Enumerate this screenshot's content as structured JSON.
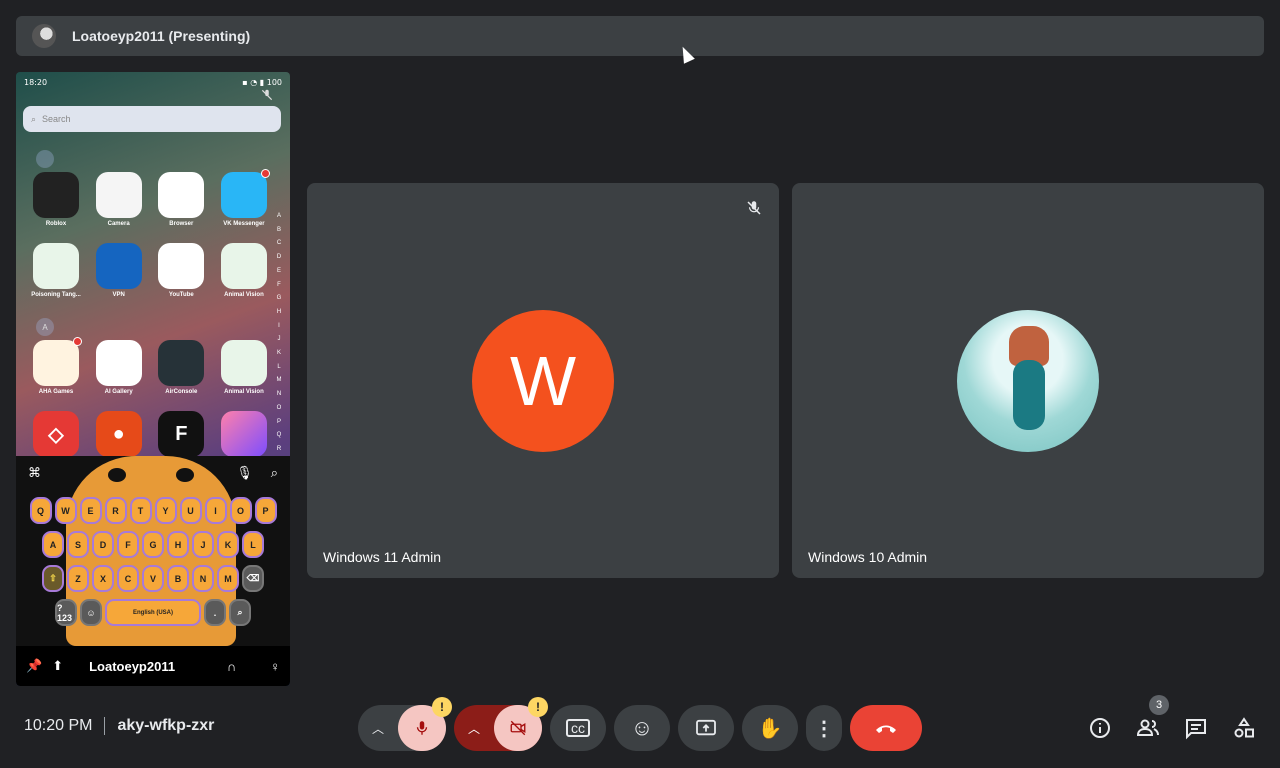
{
  "presenter_bar": {
    "title": "Loatoeyp2011 (Presenting)"
  },
  "phone": {
    "status_time": "18:20",
    "search_placeholder": "Search",
    "apps": [
      [
        {
          "label": "Roblox",
          "icon": "roblox-icon",
          "color": "#222"
        },
        {
          "label": "Camera",
          "icon": "camera-icon",
          "color": "#f5f5f5"
        },
        {
          "label": "Browser",
          "icon": "browser-icon",
          "color": "#ffffff"
        },
        {
          "label": "VK Messenger",
          "icon": "messenger-icon",
          "color": "#29b6f6"
        }
      ],
      [
        {
          "label": "Poisoning Tang...",
          "icon": "eye-icon",
          "color": "#e8f5e9"
        },
        {
          "label": "VPN",
          "icon": "vpn-icon",
          "color": "#1565c0"
        },
        {
          "label": "YouTube",
          "icon": "youtube-icon",
          "color": "#ffffff"
        },
        {
          "label": "Animal Vision",
          "icon": "animal-vision-icon",
          "color": "#e8f5e9"
        }
      ],
      [
        {
          "label": "AHA Games",
          "icon": "games-icon",
          "color": "#fff3e0"
        },
        {
          "label": "AI Gallery",
          "icon": "gallery-icon",
          "color": "#ffffff"
        },
        {
          "label": "AirConsole",
          "icon": "airconsole-icon",
          "color": "#263238"
        },
        {
          "label": "Animal Vision",
          "icon": "animal-vision-icon",
          "color": "#e8f5e9"
        }
      ]
    ],
    "index_letters": "A B C D E F G H I J K L M N O P Q R",
    "letter_bubble": "A",
    "keyboard": {
      "row1": [
        "Q",
        "W",
        "E",
        "R",
        "T",
        "Y",
        "U",
        "I",
        "O",
        "P"
      ],
      "row2": [
        "A",
        "S",
        "D",
        "F",
        "G",
        "H",
        "J",
        "K",
        "L"
      ],
      "row3": [
        "Z",
        "X",
        "C",
        "V",
        "B",
        "N",
        "M"
      ],
      "numkey": "?123",
      "space_label": "English (USA)",
      "period": "."
    },
    "footer_name": "Loatoeyp2011"
  },
  "tiles": [
    {
      "name": "Windows 11 Admin",
      "avatar_letter": "W",
      "muted": true
    },
    {
      "name": "Windows 10 Admin",
      "muted": false
    }
  ],
  "bottom": {
    "time": "10:20 PM",
    "meeting_code": "aky-wfkp-zxr",
    "warn_mark": "!",
    "participants_count": "3"
  },
  "colors": {
    "end_call": "#ea4335",
    "mic_off_bg": "#f5c6c2",
    "warning": "#fdd663",
    "avatar_w": "#f4511e"
  }
}
